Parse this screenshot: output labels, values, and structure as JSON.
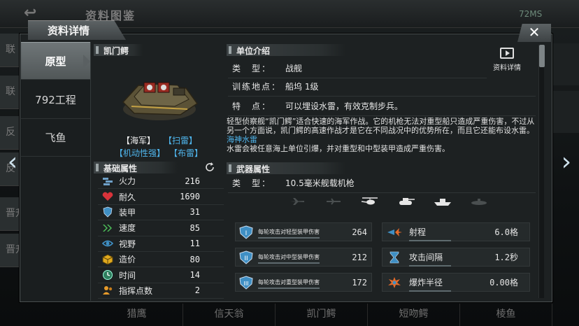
{
  "background": {
    "screen_title": "资料图鉴",
    "ping": "72MS",
    "side_items": [
      "联",
      "联",
      "反",
      "反",
      "晋升",
      "晋升"
    ],
    "bottom_tabs": [
      "猎鹰",
      "信天翁",
      "凯门鳄",
      "短吻鳄",
      "棱鱼"
    ]
  },
  "dialog": {
    "title": "资料详情",
    "close_label": "✕"
  },
  "left_tabs": [
    {
      "label": "原型",
      "active": true
    },
    {
      "label": "792工程",
      "active": false
    },
    {
      "label": "飞鱼",
      "active": false
    }
  ],
  "unit": {
    "name": "凯门鳄",
    "tags": [
      "【海军】",
      "【扫雷】",
      "【机动性强】",
      "【布雷】"
    ]
  },
  "base_attrs": {
    "title": "基础属性",
    "rows": [
      {
        "icon": "firepower-icon",
        "label": "火力",
        "value": "216"
      },
      {
        "icon": "heart-icon",
        "label": "耐久",
        "value": "1690"
      },
      {
        "icon": "armor-shield-icon",
        "label": "装甲",
        "value": "31"
      },
      {
        "icon": "speed-chevrons-icon",
        "label": "速度",
        "value": "85"
      },
      {
        "icon": "eye-icon",
        "label": "视野",
        "value": "11"
      },
      {
        "icon": "cube-icon",
        "label": "造价",
        "value": "80"
      },
      {
        "icon": "clock-icon",
        "label": "时间",
        "value": "14"
      },
      {
        "icon": "commander-icon",
        "label": "指挥点数",
        "value": "2"
      }
    ]
  },
  "intro": {
    "title": "单位介绍",
    "detail_label": "资料详情",
    "rows": [
      {
        "key": "类　型：",
        "value": "战舰"
      },
      {
        "key": "训练地点：",
        "value": "船坞 1级"
      },
      {
        "key": "特　点：",
        "value": "可以埋设水雷，有效克制步兵。"
      }
    ],
    "desc": "轻型侦察舰“凯门鳄”适合快速的海军作战。它的机枪无法对重型船只造成严重伤害，不过从另一个方面说，凯门鳄的高速作战才是它在不同战况中的优势所在，而且它还能布设水雷。",
    "mine_title": "海神水雷",
    "mine_desc": "水雷会被任意海上单位引爆，并对重型和中型装甲造成严重伤害。"
  },
  "weapon": {
    "title": "武器属性",
    "type_key": "类　型：",
    "type_value": "10.5毫米舰载机枪",
    "targets": [
      "plane-icon",
      "jet-icon",
      "helicopter-icon",
      "tank-icon",
      "ship-icon",
      "submarine-icon"
    ],
    "damage_rows": [
      {
        "label": "每轮攻击对轻型装甲伤害",
        "value": "264",
        "tier": "I"
      },
      {
        "label": "每轮攻击对中型装甲伤害",
        "value": "212",
        "tier": "II"
      },
      {
        "label": "每轮攻击对重型装甲伤害",
        "value": "172",
        "tier": "III"
      }
    ],
    "range_rows": [
      {
        "icon": "range-icon",
        "label": "射程",
        "value": "6.0格"
      },
      {
        "icon": "hourglass-icon",
        "label": "攻击间隔",
        "value": "1.2秒"
      },
      {
        "icon": "explosion-icon",
        "label": "爆炸半径",
        "value": "0.00格"
      }
    ]
  },
  "colors": {
    "highlight_blue": "#4fb5ec",
    "panel": "#1d2122"
  }
}
